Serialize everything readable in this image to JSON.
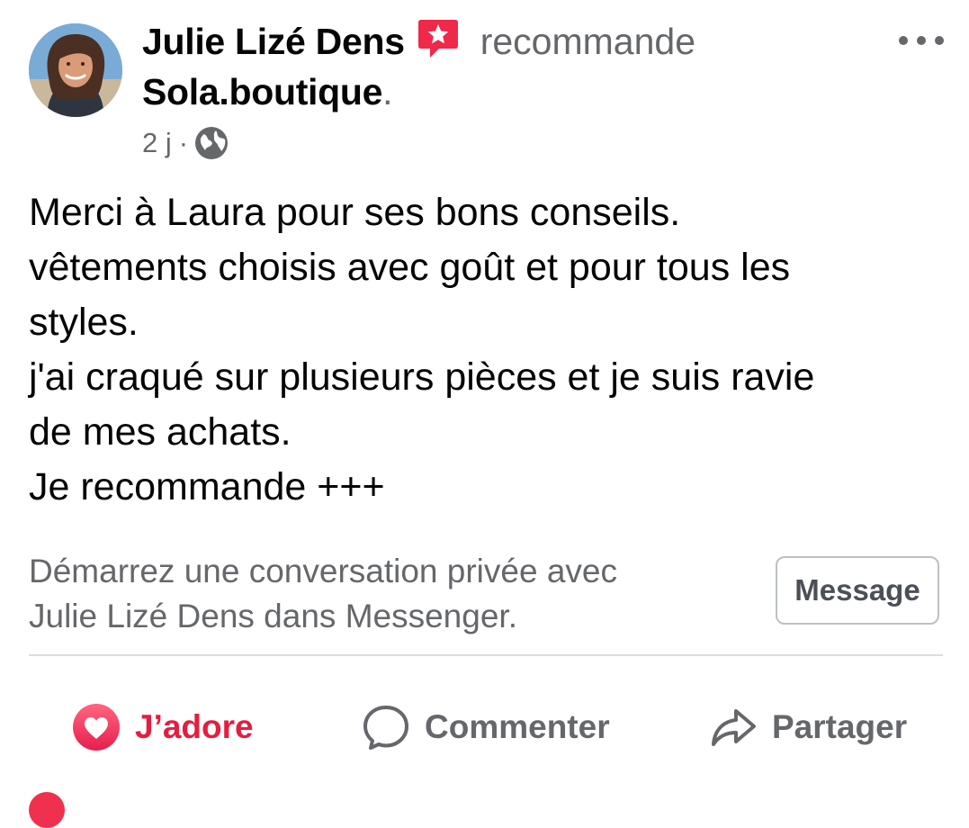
{
  "post": {
    "author": "Julie Lizé Dens",
    "action_verb": "recommande",
    "page_name": "Sola.boutique",
    "page_suffix": ".",
    "timestamp": "2 j",
    "separator": "·",
    "privacy_icon": "globe-icon",
    "more_icon": "more-options-icon",
    "body_lines": [
      "Merci à Laura pour ses bons conseils.",
      "vêtements choisis avec goût et pour tous les",
      "styles.",
      "j'ai craqué sur plusieurs pièces et je suis ravie",
      "de mes achats.",
      "Je recommande +++"
    ]
  },
  "messenger_prompt": {
    "lines": [
      "Démarrez une conversation privée avec",
      "Julie Lizé Dens dans Messenger."
    ],
    "button_label": "Message"
  },
  "actions": {
    "love_label": "J’adore",
    "comment_label": "Commenter",
    "share_label": "Partager"
  },
  "colors": {
    "love": "#e41e3f",
    "recommend_icon": "#f02849",
    "secondary_text": "#65676b",
    "divider": "#dadde1"
  }
}
